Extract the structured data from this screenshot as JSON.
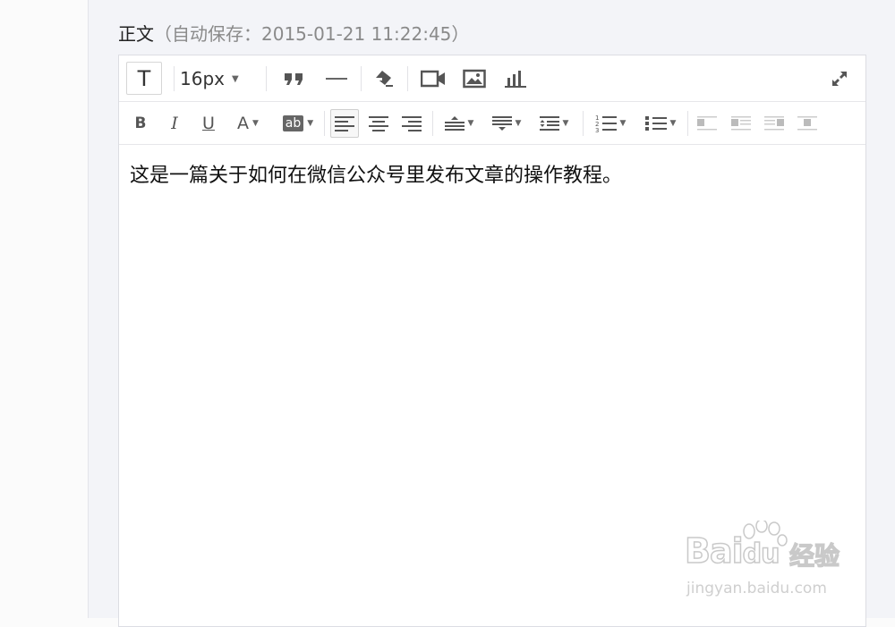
{
  "header": {
    "section_label": "正文",
    "autosave_text": "（自动保存：2015-01-21 11:22:45）"
  },
  "toolbar": {
    "row1": {
      "text_style_label": "T",
      "font_size_value": "16px",
      "icons": [
        "quote-icon",
        "horizontal-rule-icon",
        "format-brush-icon",
        "video-icon",
        "image-icon",
        "chart-icon",
        "fullscreen-icon"
      ]
    },
    "row2": {
      "bold_label": "B",
      "italic_label": "I",
      "underline_label": "U",
      "font_color_label": "A",
      "highlight_label": "ab",
      "icons": [
        "align-left-icon",
        "align-center-icon",
        "align-right-icon",
        "space-before-icon",
        "space-after-icon",
        "line-height-icon",
        "ordered-list-icon",
        "unordered-list-icon",
        "float-left-icon",
        "float-left-text-icon",
        "float-right-text-icon",
        "float-none-icon"
      ]
    }
  },
  "editor": {
    "content": "这是一篇关于如何在微信公众号里发布文章的操作教程。"
  },
  "watermark": {
    "brand": "Bai",
    "brand_suffix": "du",
    "brand_cn": "经验",
    "url": "jingyan.baidu.com"
  }
}
